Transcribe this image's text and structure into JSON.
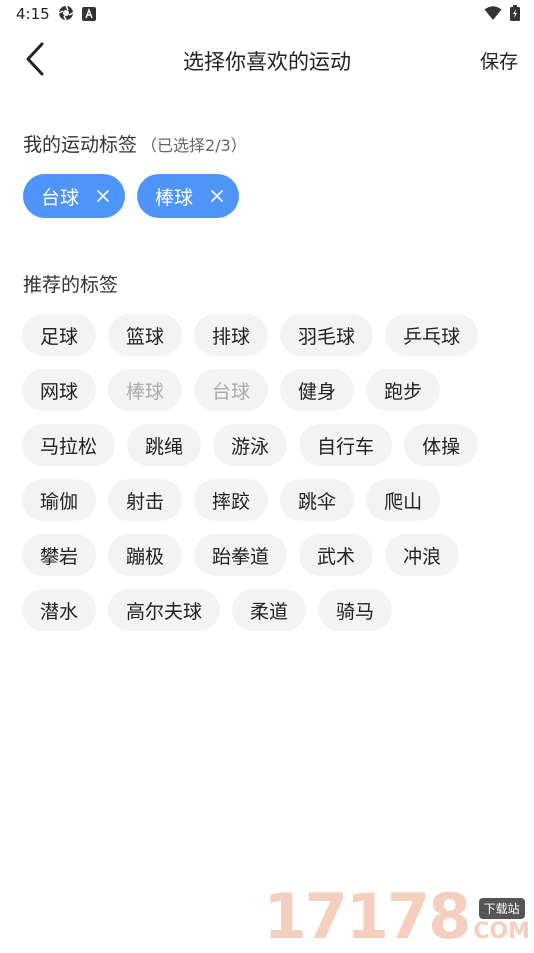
{
  "status_bar": {
    "time": "4:15"
  },
  "header": {
    "title": "选择你喜欢的运动",
    "save_label": "保存"
  },
  "my_tags": {
    "title": "我的运动标签",
    "note": "（已选择2/3）",
    "items": [
      "台球",
      "棒球"
    ]
  },
  "recommended": {
    "title": "推荐的标签",
    "rows": [
      [
        {
          "label": "足球",
          "disabled": false
        },
        {
          "label": "篮球",
          "disabled": false
        },
        {
          "label": "排球",
          "disabled": false
        },
        {
          "label": "羽毛球",
          "disabled": false
        },
        {
          "label": "乒乓球",
          "disabled": false
        }
      ],
      [
        {
          "label": "网球",
          "disabled": false
        },
        {
          "label": "棒球",
          "disabled": true
        },
        {
          "label": "台球",
          "disabled": true
        },
        {
          "label": "健身",
          "disabled": false
        },
        {
          "label": "跑步",
          "disabled": false
        }
      ],
      [
        {
          "label": "马拉松",
          "disabled": false
        },
        {
          "label": "跳绳",
          "disabled": false
        },
        {
          "label": "游泳",
          "disabled": false
        },
        {
          "label": "自行车",
          "disabled": false
        },
        {
          "label": "体操",
          "disabled": false
        }
      ],
      [
        {
          "label": "瑜伽",
          "disabled": false
        },
        {
          "label": "射击",
          "disabled": false
        },
        {
          "label": "摔跤",
          "disabled": false
        },
        {
          "label": "跳伞",
          "disabled": false
        },
        {
          "label": "爬山",
          "disabled": false
        }
      ],
      [
        {
          "label": "攀岩",
          "disabled": false
        },
        {
          "label": "蹦极",
          "disabled": false
        },
        {
          "label": "跆拳道",
          "disabled": false
        },
        {
          "label": "武术",
          "disabled": false
        },
        {
          "label": "冲浪",
          "disabled": false
        }
      ],
      [
        {
          "label": "潜水",
          "disabled": false
        },
        {
          "label": "高尔夫球",
          "disabled": false
        },
        {
          "label": "柔道",
          "disabled": false
        },
        {
          "label": "骑马",
          "disabled": false
        }
      ]
    ]
  },
  "watermark": {
    "number": "17178",
    "badge": "下载站",
    "suffix": "COM"
  },
  "colors": {
    "accent": "#4f94f9",
    "tag_bg": "#f3f3f3",
    "disabled_text": "#aaaaaa"
  },
  "icons": {
    "back": "chevron-left-icon",
    "chip_remove": "close-icon",
    "status_left": [
      "aperture-icon",
      "app-notification-icon"
    ],
    "status_right": [
      "wifi-icon",
      "battery-icon"
    ]
  }
}
